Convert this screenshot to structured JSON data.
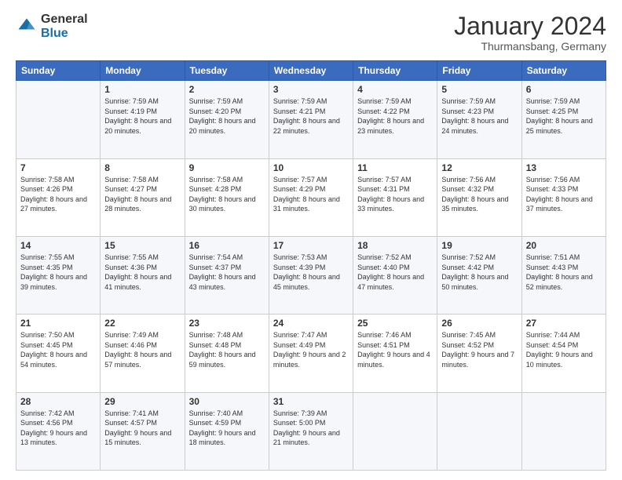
{
  "logo": {
    "general": "General",
    "blue": "Blue"
  },
  "header": {
    "month": "January 2024",
    "location": "Thurmansbang, Germany"
  },
  "days_of_week": [
    "Sunday",
    "Monday",
    "Tuesday",
    "Wednesday",
    "Thursday",
    "Friday",
    "Saturday"
  ],
  "weeks": [
    [
      {
        "day": "",
        "sunrise": "",
        "sunset": "",
        "daylight": ""
      },
      {
        "day": "1",
        "sunrise": "Sunrise: 7:59 AM",
        "sunset": "Sunset: 4:19 PM",
        "daylight": "Daylight: 8 hours and 20 minutes."
      },
      {
        "day": "2",
        "sunrise": "Sunrise: 7:59 AM",
        "sunset": "Sunset: 4:20 PM",
        "daylight": "Daylight: 8 hours and 20 minutes."
      },
      {
        "day": "3",
        "sunrise": "Sunrise: 7:59 AM",
        "sunset": "Sunset: 4:21 PM",
        "daylight": "Daylight: 8 hours and 22 minutes."
      },
      {
        "day": "4",
        "sunrise": "Sunrise: 7:59 AM",
        "sunset": "Sunset: 4:22 PM",
        "daylight": "Daylight: 8 hours and 23 minutes."
      },
      {
        "day": "5",
        "sunrise": "Sunrise: 7:59 AM",
        "sunset": "Sunset: 4:23 PM",
        "daylight": "Daylight: 8 hours and 24 minutes."
      },
      {
        "day": "6",
        "sunrise": "Sunrise: 7:59 AM",
        "sunset": "Sunset: 4:25 PM",
        "daylight": "Daylight: 8 hours and 25 minutes."
      }
    ],
    [
      {
        "day": "7",
        "sunrise": "Sunrise: 7:58 AM",
        "sunset": "Sunset: 4:26 PM",
        "daylight": "Daylight: 8 hours and 27 minutes."
      },
      {
        "day": "8",
        "sunrise": "Sunrise: 7:58 AM",
        "sunset": "Sunset: 4:27 PM",
        "daylight": "Daylight: 8 hours and 28 minutes."
      },
      {
        "day": "9",
        "sunrise": "Sunrise: 7:58 AM",
        "sunset": "Sunset: 4:28 PM",
        "daylight": "Daylight: 8 hours and 30 minutes."
      },
      {
        "day": "10",
        "sunrise": "Sunrise: 7:57 AM",
        "sunset": "Sunset: 4:29 PM",
        "daylight": "Daylight: 8 hours and 31 minutes."
      },
      {
        "day": "11",
        "sunrise": "Sunrise: 7:57 AM",
        "sunset": "Sunset: 4:31 PM",
        "daylight": "Daylight: 8 hours and 33 minutes."
      },
      {
        "day": "12",
        "sunrise": "Sunrise: 7:56 AM",
        "sunset": "Sunset: 4:32 PM",
        "daylight": "Daylight: 8 hours and 35 minutes."
      },
      {
        "day": "13",
        "sunrise": "Sunrise: 7:56 AM",
        "sunset": "Sunset: 4:33 PM",
        "daylight": "Daylight: 8 hours and 37 minutes."
      }
    ],
    [
      {
        "day": "14",
        "sunrise": "Sunrise: 7:55 AM",
        "sunset": "Sunset: 4:35 PM",
        "daylight": "Daylight: 8 hours and 39 minutes."
      },
      {
        "day": "15",
        "sunrise": "Sunrise: 7:55 AM",
        "sunset": "Sunset: 4:36 PM",
        "daylight": "Daylight: 8 hours and 41 minutes."
      },
      {
        "day": "16",
        "sunrise": "Sunrise: 7:54 AM",
        "sunset": "Sunset: 4:37 PM",
        "daylight": "Daylight: 8 hours and 43 minutes."
      },
      {
        "day": "17",
        "sunrise": "Sunrise: 7:53 AM",
        "sunset": "Sunset: 4:39 PM",
        "daylight": "Daylight: 8 hours and 45 minutes."
      },
      {
        "day": "18",
        "sunrise": "Sunrise: 7:52 AM",
        "sunset": "Sunset: 4:40 PM",
        "daylight": "Daylight: 8 hours and 47 minutes."
      },
      {
        "day": "19",
        "sunrise": "Sunrise: 7:52 AM",
        "sunset": "Sunset: 4:42 PM",
        "daylight": "Daylight: 8 hours and 50 minutes."
      },
      {
        "day": "20",
        "sunrise": "Sunrise: 7:51 AM",
        "sunset": "Sunset: 4:43 PM",
        "daylight": "Daylight: 8 hours and 52 minutes."
      }
    ],
    [
      {
        "day": "21",
        "sunrise": "Sunrise: 7:50 AM",
        "sunset": "Sunset: 4:45 PM",
        "daylight": "Daylight: 8 hours and 54 minutes."
      },
      {
        "day": "22",
        "sunrise": "Sunrise: 7:49 AM",
        "sunset": "Sunset: 4:46 PM",
        "daylight": "Daylight: 8 hours and 57 minutes."
      },
      {
        "day": "23",
        "sunrise": "Sunrise: 7:48 AM",
        "sunset": "Sunset: 4:48 PM",
        "daylight": "Daylight: 8 hours and 59 minutes."
      },
      {
        "day": "24",
        "sunrise": "Sunrise: 7:47 AM",
        "sunset": "Sunset: 4:49 PM",
        "daylight": "Daylight: 9 hours and 2 minutes."
      },
      {
        "day": "25",
        "sunrise": "Sunrise: 7:46 AM",
        "sunset": "Sunset: 4:51 PM",
        "daylight": "Daylight: 9 hours and 4 minutes."
      },
      {
        "day": "26",
        "sunrise": "Sunrise: 7:45 AM",
        "sunset": "Sunset: 4:52 PM",
        "daylight": "Daylight: 9 hours and 7 minutes."
      },
      {
        "day": "27",
        "sunrise": "Sunrise: 7:44 AM",
        "sunset": "Sunset: 4:54 PM",
        "daylight": "Daylight: 9 hours and 10 minutes."
      }
    ],
    [
      {
        "day": "28",
        "sunrise": "Sunrise: 7:42 AM",
        "sunset": "Sunset: 4:56 PM",
        "daylight": "Daylight: 9 hours and 13 minutes."
      },
      {
        "day": "29",
        "sunrise": "Sunrise: 7:41 AM",
        "sunset": "Sunset: 4:57 PM",
        "daylight": "Daylight: 9 hours and 15 minutes."
      },
      {
        "day": "30",
        "sunrise": "Sunrise: 7:40 AM",
        "sunset": "Sunset: 4:59 PM",
        "daylight": "Daylight: 9 hours and 18 minutes."
      },
      {
        "day": "31",
        "sunrise": "Sunrise: 7:39 AM",
        "sunset": "Sunset: 5:00 PM",
        "daylight": "Daylight: 9 hours and 21 minutes."
      },
      {
        "day": "",
        "sunrise": "",
        "sunset": "",
        "daylight": ""
      },
      {
        "day": "",
        "sunrise": "",
        "sunset": "",
        "daylight": ""
      },
      {
        "day": "",
        "sunrise": "",
        "sunset": "",
        "daylight": ""
      }
    ]
  ]
}
